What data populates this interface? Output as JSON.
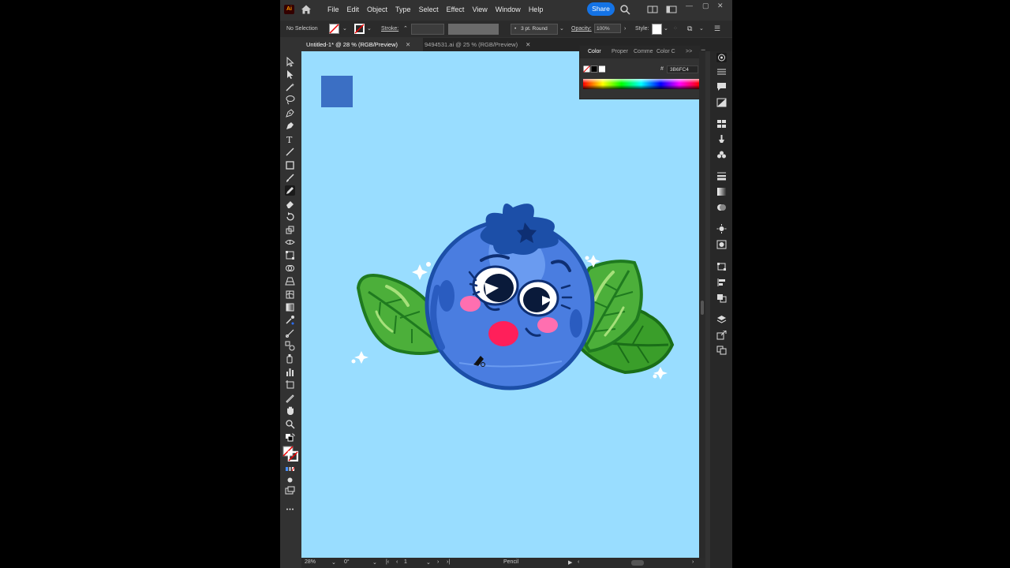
{
  "app": {
    "logo": "Ai",
    "menu": [
      "File",
      "Edit",
      "Object",
      "Type",
      "Select",
      "Effect",
      "View",
      "Window",
      "Help"
    ],
    "share_label": "Share",
    "window_controls": [
      "—",
      "▢",
      "✕"
    ]
  },
  "control_bar": {
    "selection_label": "No Selection",
    "stroke_label": "Stroke:",
    "brush_label": "3 pt. Round",
    "opacity_label": "Opacity:",
    "opacity_value": "100%",
    "style_label": "Style:"
  },
  "document_tabs": [
    {
      "label": "Untitled-1* @ 28 % (RGB/Preview)",
      "close": "✕"
    },
    {
      "label": "9494531.ai @ 25 % (RGB/Preview)",
      "close": "✕"
    }
  ],
  "color_panel": {
    "tabs": [
      "Color",
      "Proper",
      "Comme",
      "Color C"
    ],
    "expand": ">>",
    "menu": "☰",
    "hex_prefix": "#",
    "hex_value": "3B6FC4"
  },
  "status_bar": {
    "zoom": "28%",
    "rotation": "0°",
    "artboard": "1",
    "tool": "Pencil"
  },
  "colors": {
    "canvas": "#99ddff",
    "swatch": "#3b6fc4",
    "blueberry_body": "#4a7de0",
    "blueberry_outline": "#1c4fa8",
    "leaf": "#4caf3a",
    "leaf_dark": "#1f7a1f",
    "cheek": "#ff6fb0",
    "mouth": "#ff1f5a",
    "accent": "#1473e6"
  }
}
